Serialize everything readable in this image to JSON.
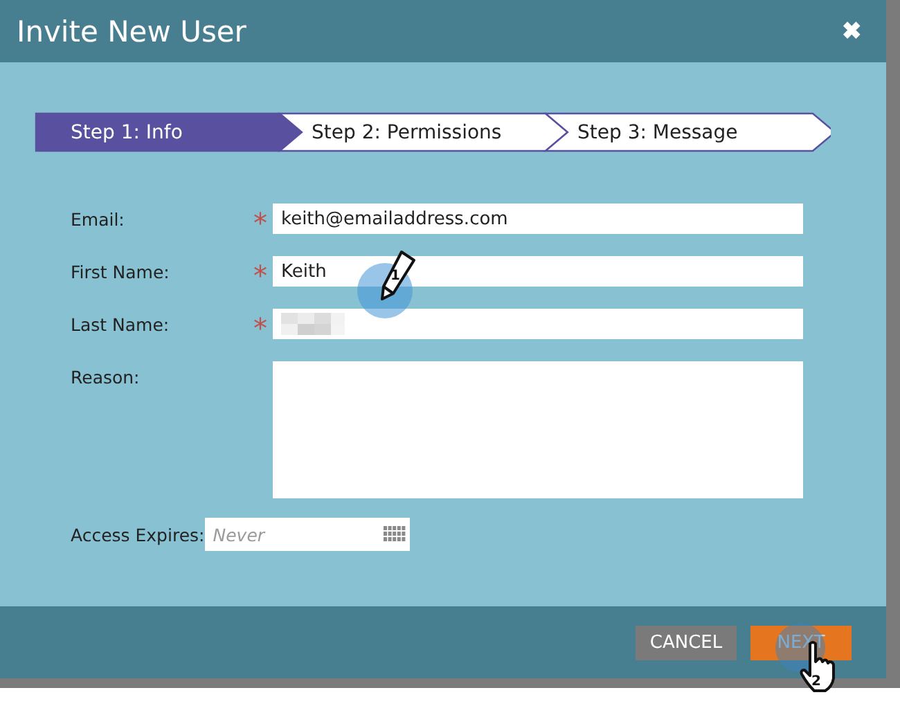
{
  "window": {
    "title": "Invite New User",
    "close": "✖"
  },
  "steps": [
    {
      "label": "Step 1: Info",
      "selected": true
    },
    {
      "label": "Step 2: Permissions",
      "selected": false
    },
    {
      "label": "Step 3: Message",
      "selected": false
    }
  ],
  "fields": [
    {
      "label": "Email:",
      "required": true,
      "kind": "text",
      "value": "keith@emailaddress.com"
    },
    {
      "label": "First Name:",
      "required": true,
      "kind": "text",
      "value": "Keith"
    },
    {
      "label": "Last Name:",
      "required": true,
      "kind": "redacted"
    },
    {
      "label": "Reason:",
      "kind": "textarea"
    },
    {
      "label": "Access Expires:",
      "kind": "date",
      "placeholder": "Never"
    }
  ],
  "required_mark": "*",
  "buttons": [
    {
      "label": "CANCEL",
      "kind": "secondary"
    },
    {
      "label": "NEXT",
      "kind": "primary"
    }
  ],
  "callouts": [
    {
      "number": "1",
      "kind": "pencil"
    },
    {
      "number": "2",
      "kind": "hand"
    }
  ]
}
